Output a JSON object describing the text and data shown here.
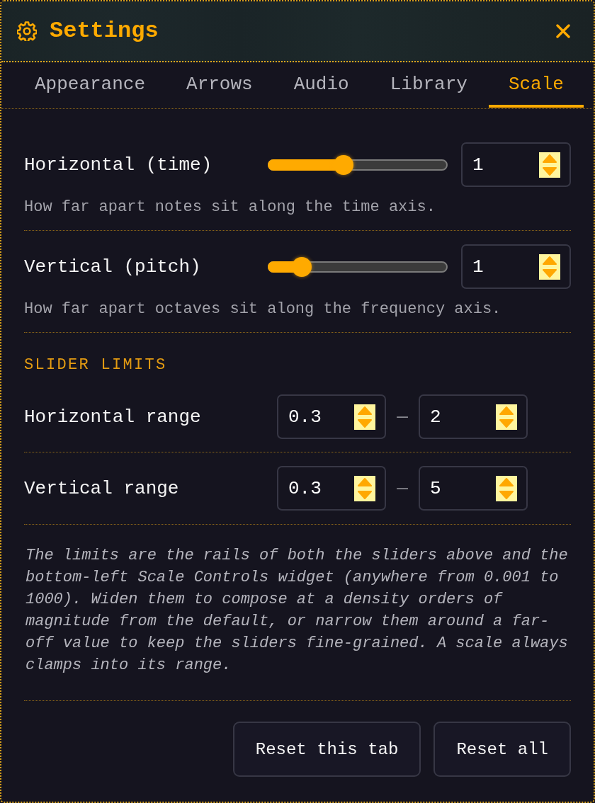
{
  "window": {
    "title": "Settings"
  },
  "tabs": [
    {
      "label": "Appearance",
      "selected": false
    },
    {
      "label": "Arrows",
      "selected": false
    },
    {
      "label": "Audio",
      "selected": false
    },
    {
      "label": "Library",
      "selected": false
    },
    {
      "label": "Scale",
      "selected": true
    }
  ],
  "scale_settings": [
    {
      "label": "Horizontal (time)",
      "level": 0.41,
      "value": "1",
      "description": "How far apart notes sit along the time axis."
    },
    {
      "label": "Vertical (pitch)",
      "level": 0.15,
      "value": "1",
      "description": "How far apart octaves sit along the frequency axis."
    }
  ],
  "slider_limits": {
    "heading": "SLIDER LIMITS",
    "rows": [
      {
        "label": "Horizontal range",
        "min": "0.3",
        "separator": "—",
        "max": "2"
      },
      {
        "label": "Vertical range",
        "min": "0.3",
        "separator": "—",
        "max": "5"
      }
    ],
    "note": "The limits are the rails of both the sliders above and the bottom-left Scale Controls widget (anywhere from 0.001 to 1000). Widen them to compose at a density orders of magnitude from the default, or narrow them around a far-off value to keep the sliders fine-grained. A scale always clamps into its range."
  },
  "buttons": [
    "Reset this tab",
    "Reset all"
  ]
}
